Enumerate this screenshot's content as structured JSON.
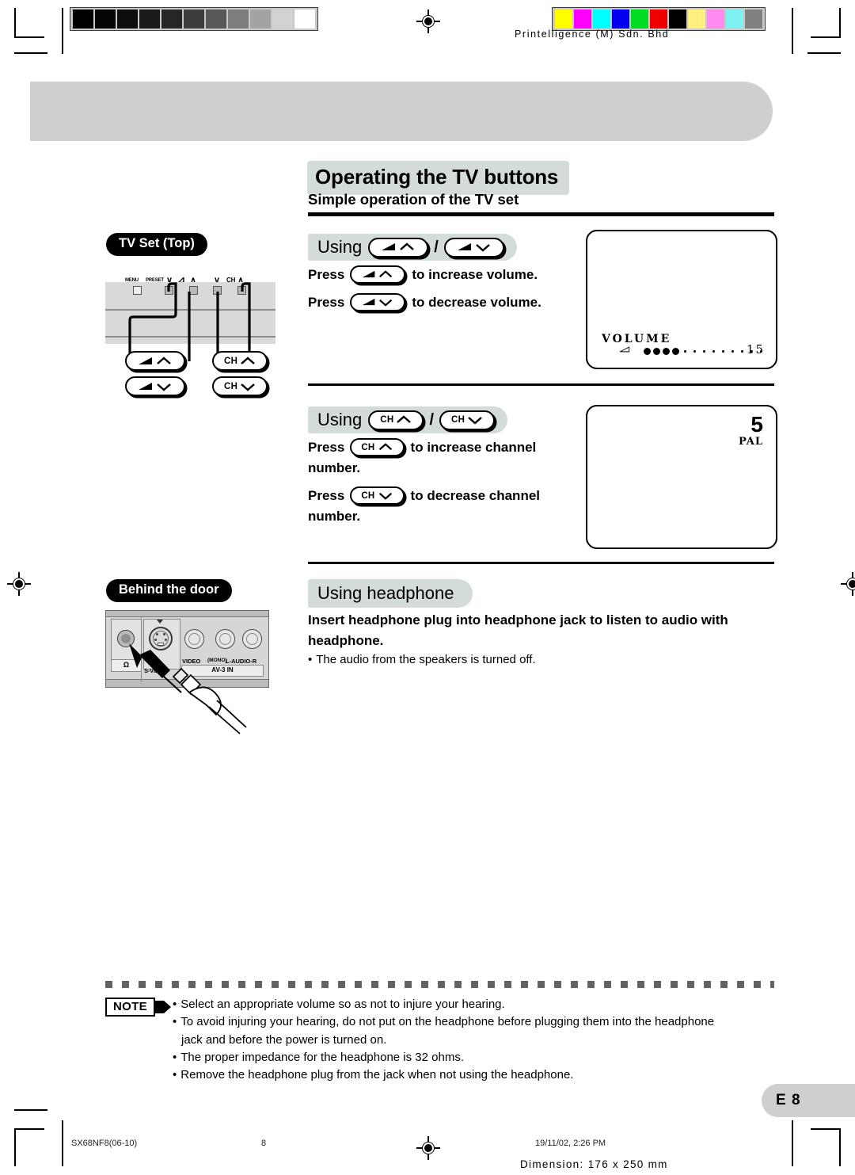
{
  "print_marks": {
    "imprint": "Printelligence (M) Sdn. Bhd",
    "dimension_note": "Dimension: 176 x 250 mm",
    "grayscale_patches": [
      "#000000",
      "#050505",
      "#0d0d0d",
      "#1a1a1a",
      "#262626",
      "#3d3d3d",
      "#585858",
      "#7d7d7d",
      "#a3a3a3",
      "#d2d2d2",
      "#ffffff"
    ],
    "color_patches": [
      "#ffff00",
      "#ff00ff",
      "#00ffff",
      "#0000ee",
      "#00dd22",
      "#ee0000",
      "#000000",
      "#fff07f",
      "#ff8cf0",
      "#7ef2f2",
      "#808080"
    ]
  },
  "page": {
    "title": "Operating the TV buttons",
    "subtitle": "Simple operation of the TV set",
    "page_number_label": "E 8"
  },
  "left_column": {
    "tvset_tag": "TV Set (Top)",
    "door_tag": "Behind the door",
    "top_panel_labels": {
      "menu": "MENU",
      "preset": "PRESET",
      "volume_group": "⊿",
      "channel_group": "CH",
      "down_glyph": "∨",
      "up_glyph": "∧"
    },
    "callout_buttons": [
      {
        "text": "",
        "icon": "volume-up-icon"
      },
      {
        "text": "",
        "icon": "volume-down-icon"
      },
      {
        "text": "CH",
        "icon": "channel-up-icon"
      },
      {
        "text": "CH",
        "icon": "channel-down-icon"
      }
    ],
    "connector_labels": {
      "headphone": "Ω",
      "svideo": "S-VIDEO",
      "video": "VIDEO",
      "mono": "(MONO)",
      "audio": "L-AUDIO-R",
      "av_in": "AV-3 IN"
    }
  },
  "sections": [
    {
      "heading_prefix": "Using",
      "heading_keys": [
        {
          "text": "",
          "icon": "volume-up-icon"
        },
        {
          "text": "",
          "icon": "volume-down-icon"
        }
      ],
      "separator": "/",
      "lines": [
        {
          "press": "Press",
          "key": {
            "text": "",
            "icon": "volume-up-icon"
          },
          "after": "to increase volume."
        },
        {
          "press": "Press",
          "key": {
            "text": "",
            "icon": "volume-down-icon"
          },
          "after": "to decrease volume."
        }
      ],
      "screen": {
        "type": "volume",
        "osd_label": "VOLUME",
        "osd_value": "15",
        "filled_dots": 4,
        "empty_dots": 9
      }
    },
    {
      "heading_prefix": "Using",
      "heading_keys": [
        {
          "text": "CH",
          "icon": "channel-up-icon"
        },
        {
          "text": "CH",
          "icon": "channel-down-icon"
        }
      ],
      "separator": "/",
      "lines": [
        {
          "press": "Press",
          "key": {
            "text": "CH",
            "icon": "channel-up-icon"
          },
          "after": "to increase channel",
          "wrap": "number."
        },
        {
          "press": "Press",
          "key": {
            "text": "CH",
            "icon": "channel-down-icon"
          },
          "after": "to decrease channel",
          "wrap": "number."
        }
      ],
      "screen": {
        "type": "channel",
        "channel_number": "5",
        "system_label": "PAL"
      }
    }
  ],
  "headphone": {
    "heading": "Using headphone",
    "body_line1": "Insert headphone plug into headphone jack to listen to audio with",
    "body_line2": "headphone.",
    "bullet": "The audio from the speakers is turned off."
  },
  "note": {
    "badge": "NOTE",
    "items": [
      "Select an appropriate volume so as not to injure your hearing.",
      "To avoid injuring your hearing, do not put on the headphone before plugging them into the headphone",
      "The proper impedance for the headphone is 32 ohms.",
      "Remove the headphone plug from the jack when not using the headphone."
    ],
    "item2_continuation": "jack and before the power is turned on."
  },
  "footer": {
    "doc_code": "SX68NF8(06-10)",
    "page_num": "8",
    "timestamp": "19/11/02, 2:26 PM"
  },
  "colors": {
    "band_gray": "#cfcfcf",
    "pill_green_gray": "#d3dcd8",
    "panel_gray": "#d9d9d9"
  }
}
